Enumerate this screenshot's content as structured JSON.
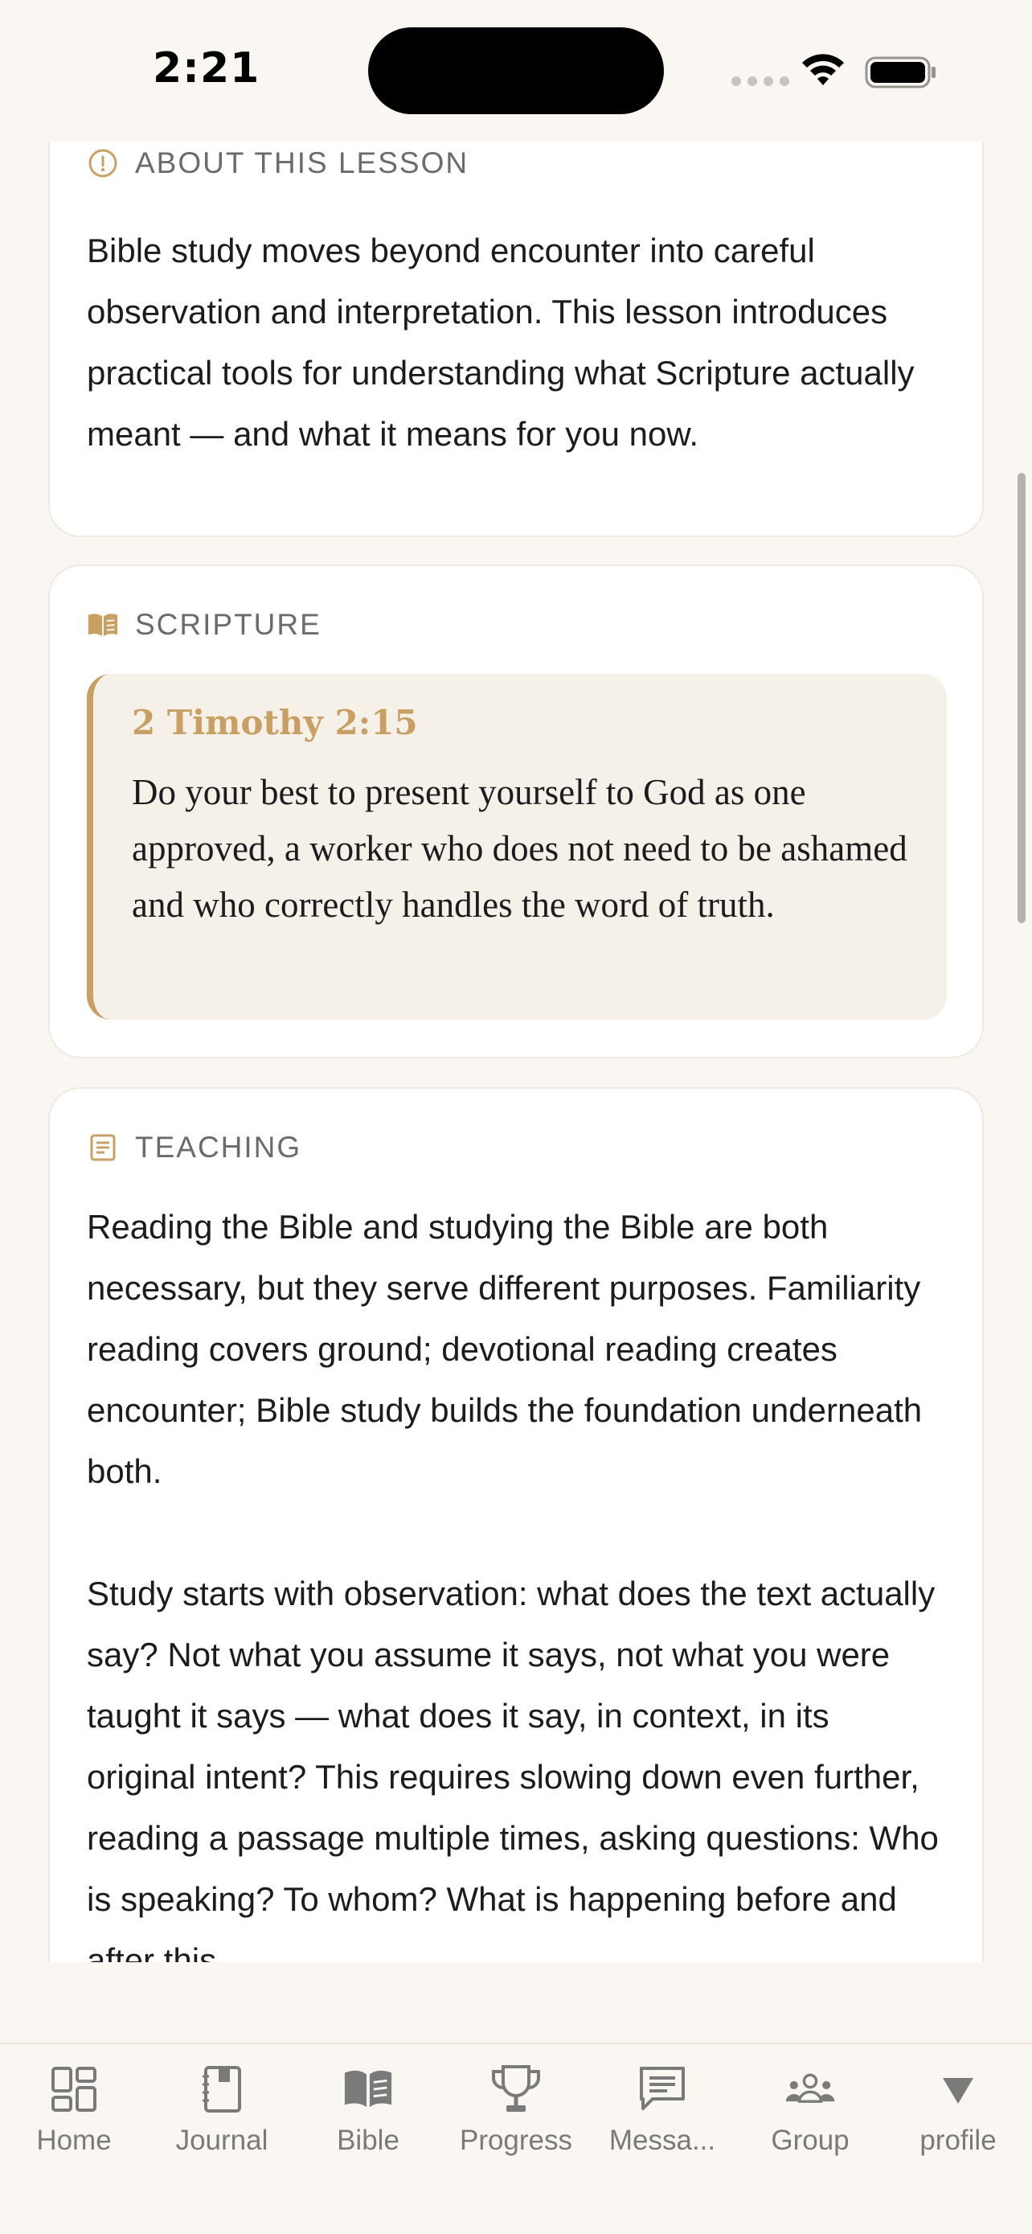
{
  "status_bar": {
    "time": "2:21"
  },
  "colors": {
    "accent": "#c9a063",
    "background": "#faf7f2",
    "card": "#ffffff",
    "verse_bg": "#f5f0e8",
    "tab_icon": "#7a7a7a"
  },
  "about": {
    "header": "ABOUT THIS LESSON",
    "icon": "info-circle-icon",
    "text": "Bible study moves beyond encounter into careful observation and interpretation. This lesson introduces practical tools for understanding what Scripture actually meant — and what it means for you now."
  },
  "scripture": {
    "header": "SCRIPTURE",
    "icon": "open-book-icon",
    "reference": "2 Timothy 2:15",
    "text": "Do your best to present yourself to God as one approved, a worker who does not need to be ashamed and who correctly handles the word of truth."
  },
  "teaching": {
    "header": "TEACHING",
    "icon": "document-icon",
    "paragraph_1": "Reading the Bible and studying the Bible are both necessary, but they serve different purposes. Familiarity reading covers ground; devotional reading creates encounter; Bible study builds the foundation underneath both.",
    "paragraph_2": "Study starts with observation: what does the text actually say? Not what you assume it says, not what you were taught it says — what does it say, in context, in its original intent? This requires slowing down even further, reading a passage multiple times, asking questions: Who is speaking? To whom? What is happening before and after this"
  },
  "tab_bar": {
    "tabs": [
      {
        "label": "Home",
        "icon": "dashboard-grid-icon"
      },
      {
        "label": "Journal",
        "icon": "journal-icon"
      },
      {
        "label": "Bible",
        "icon": "open-book-icon"
      },
      {
        "label": "Progress",
        "icon": "trophy-icon"
      },
      {
        "label": "Messa...",
        "icon": "message-icon"
      },
      {
        "label": "Group",
        "icon": "group-icon"
      },
      {
        "label": "profile",
        "icon": "triangle-down-icon"
      }
    ]
  }
}
